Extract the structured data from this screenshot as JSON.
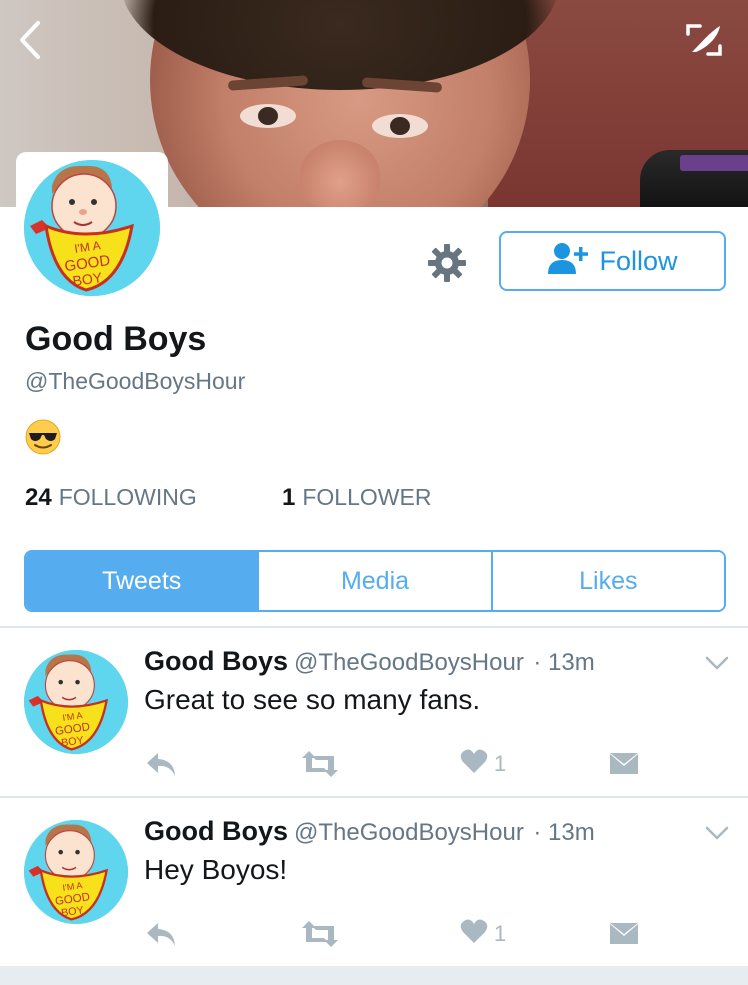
{
  "profile": {
    "name": "Good Boys",
    "handle": "@TheGoodBoysHour",
    "bio_emoji": "😎",
    "following_count": "24",
    "following_label": "FOLLOWING",
    "followers_count": "1",
    "followers_label": "FOLLOWER"
  },
  "avatar": {
    "bib_text": [
      "I'M A",
      "GOOD",
      "BOY"
    ]
  },
  "actions": {
    "follow_label": "Follow"
  },
  "tabs": [
    {
      "label": "Tweets",
      "active": true
    },
    {
      "label": "Media",
      "active": false
    },
    {
      "label": "Likes",
      "active": false
    }
  ],
  "tweets": [
    {
      "name": "Good Boys",
      "handle": "@TheGoodBoysHour",
      "time": "· 13m",
      "text": "Great to see so many fans.",
      "likes": "1"
    },
    {
      "name": "Good Boys",
      "handle": "@TheGoodBoysHour",
      "time": "· 13m",
      "text": "Hey Boyos!",
      "likes": "1"
    }
  ],
  "icons": {
    "back": "chevron-left-icon",
    "expand": "expand-icon",
    "settings": "gear-icon",
    "follow": "add-user-icon",
    "reply": "reply-icon",
    "retweet": "retweet-icon",
    "like": "heart-icon",
    "dm": "envelope-icon",
    "more": "chevron-down-icon"
  },
  "colors": {
    "accent": "#55acee",
    "follow_text": "#1b95e0",
    "muted": "#657786",
    "action_gray": "#aab8c2"
  }
}
